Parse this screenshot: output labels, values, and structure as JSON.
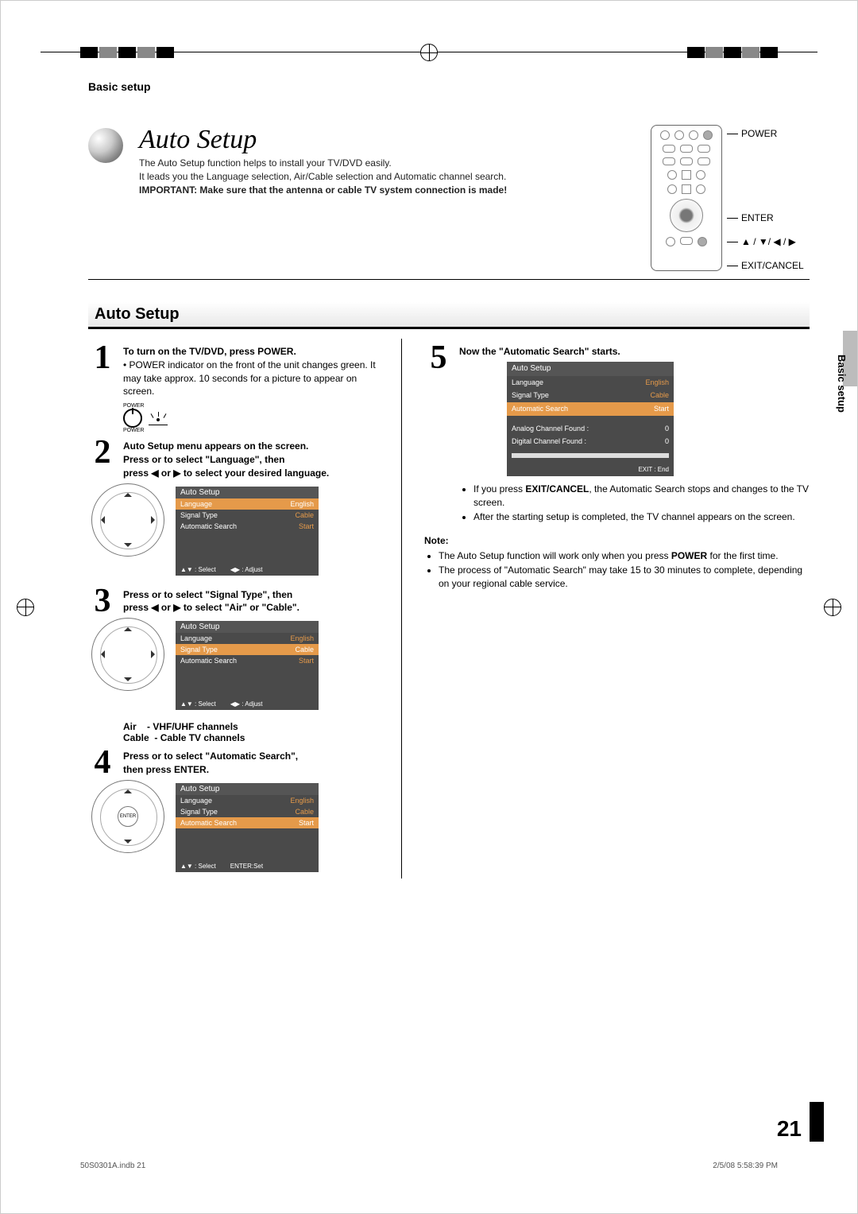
{
  "breadcrumb": "Basic setup",
  "hero": {
    "title": "Auto Setup",
    "p1": "The Auto Setup function helps to install your TV/DVD easily.",
    "p2": "It leads you the Language selection, Air/Cable selection and Automatic channel search.",
    "imp": "IMPORTANT: Make sure that the antenna or cable TV system connection is made!"
  },
  "remote_labels": {
    "power": "POWER",
    "enter": "ENTER",
    "arrows": "▲ / ▼/ ◀ / ▶",
    "exit": "EXIT/CANCEL"
  },
  "section_title": "Auto Setup",
  "steps": {
    "s1": {
      "num": "1",
      "head": "To turn on the TV/DVD, press POWER.",
      "body": "POWER indicator on the front of the unit changes green. It may take approx. 10 seconds for a picture to appear on screen.",
      "power_small": "POWER"
    },
    "s2": {
      "num": "2",
      "l1": "Auto Setup menu appears on the screen.",
      "l2a": "Press   or    to select \"Language\", then",
      "l2b": "press ◀ or ▶ to select your desired language."
    },
    "s3": {
      "num": "3",
      "l1a": "Press   or    to select \"Signal Type\", then",
      "l1b": "press ◀ or ▶ to select \"Air\" or \"Cable\"."
    },
    "air": {
      "air": "Air",
      "air_v": "- VHF/UHF channels",
      "cable": "Cable",
      "cable_v": "- Cable TV channels"
    },
    "s4": {
      "num": "4",
      "l1a": "Press   or    to select \"Automatic Search\",",
      "l1b": "then press ENTER."
    },
    "s5": {
      "num": "5",
      "head": "Now the \"Automatic Search\" starts.",
      "b1a": "If you press ",
      "b1b": "EXIT/CANCEL",
      "b1c": ", the Automatic Search stops and changes to the TV screen.",
      "b2": "After the starting setup is completed, the TV channel appears on the screen."
    }
  },
  "osd": {
    "title": "Auto Setup",
    "rows": [
      {
        "k": "Language",
        "v": "English"
      },
      {
        "k": "Signal Type",
        "v": "Cable"
      },
      {
        "k": "Automatic Search",
        "v": "Start"
      }
    ],
    "foot_sel": "▲▼ : Select",
    "foot_adj": "◀▶ : Adjust",
    "foot_enter": "ENTER:Set",
    "analog": "Analog Channel Found :",
    "analog_v": "0",
    "digital": "Digital Channel Found :",
    "digital_v": "0",
    "exit_end": "EXIT : End"
  },
  "dpad_enter": "ENTER",
  "note": {
    "head": "Note:",
    "n1a": "The Auto Setup function will work only when you press ",
    "n1b": "POWER",
    "n1c": " for the first time.",
    "n2": "The process of \"Automatic Search\" may take 15 to 30 minutes to complete, depending on your regional cable service."
  },
  "side_tab": "Basic setup",
  "page_number": "21",
  "footer_left": "50S0301A.indb   21",
  "footer_right": "2/5/08   5:58:39 PM"
}
